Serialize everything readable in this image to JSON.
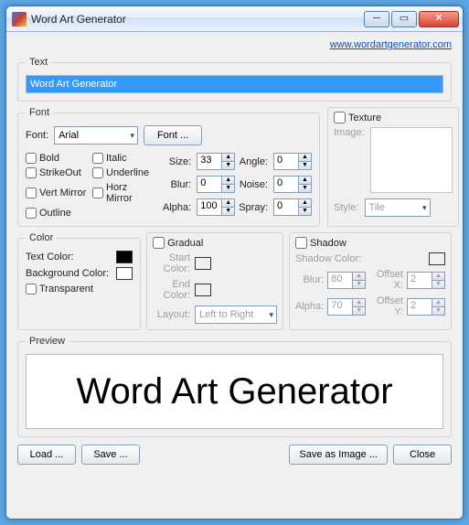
{
  "window": {
    "title": "Word Art Generator"
  },
  "link": {
    "url": "www.wordartgenerator.com"
  },
  "text": {
    "legend": "Text",
    "value": "Word Art Generator"
  },
  "font": {
    "legend": "Font",
    "font_label": "Font:",
    "font_value": "Arial",
    "font_button": "Font ...",
    "bold": "Bold",
    "italic": "Italic",
    "strikeout": "StrikeOut",
    "underline": "Underline",
    "vert": "Vert Mirror",
    "horz": "Horz Mirror",
    "outline": "Outline",
    "size_label": "Size:",
    "size_value": "33",
    "angle_label": "Angle:",
    "angle_value": "0",
    "blur_label": "Blur:",
    "blur_value": "0",
    "noise_label": "Noise:",
    "noise_value": "0",
    "alpha_label": "Alpha:",
    "alpha_value": "100",
    "spray_label": "Spray:",
    "spray_value": "0"
  },
  "texture": {
    "legend": "Texture",
    "image_label": "Image:",
    "style_label": "Style:",
    "style_value": "Tile"
  },
  "color": {
    "legend": "Color",
    "text_label": "Text Color:",
    "text_color": "#000000",
    "bg_label": "Background Color:",
    "bg_color": "#ffffff",
    "transparent": "Transparent"
  },
  "gradual": {
    "legend": "Gradual",
    "start_label": "Start Color:",
    "end_label": "End Color:",
    "layout_label": "Layout:",
    "layout_value": "Left to Right"
  },
  "shadow": {
    "legend": "Shadow",
    "color_label": "Shadow Color:",
    "blur_label": "Blur:",
    "blur_value": "80",
    "offx_label": "Offset X:",
    "offx_value": "2",
    "alpha_label": "Alpha:",
    "alpha_value": "70",
    "offy_label": "Offset Y:",
    "offy_value": "2"
  },
  "preview": {
    "legend": "Preview",
    "text": "Word Art Generator"
  },
  "buttons": {
    "load": "Load ...",
    "save": "Save ...",
    "save_image": "Save as Image ...",
    "close": "Close"
  }
}
